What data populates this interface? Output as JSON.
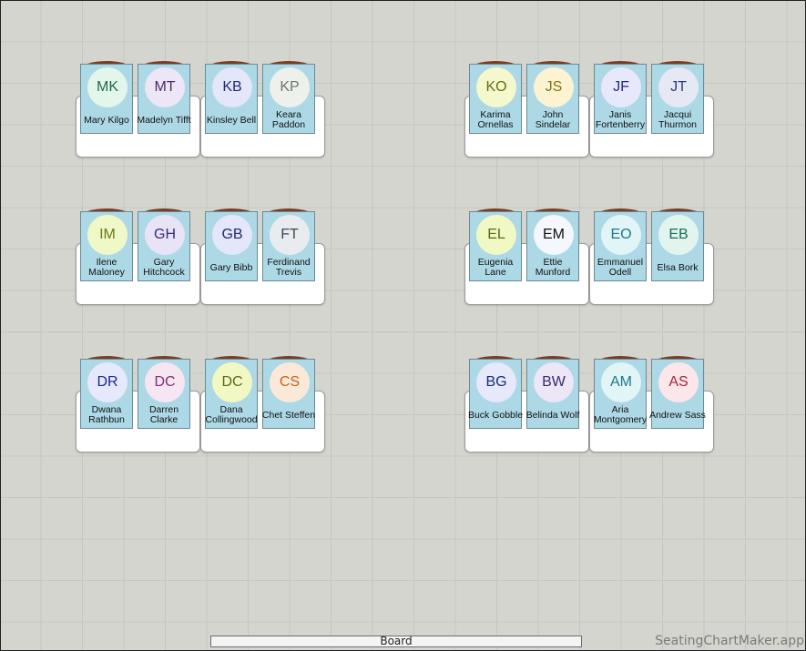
{
  "board_label": "Board",
  "watermark": "SeatingChartMaker.app",
  "colors": {
    "card_bg": "#add8e6",
    "desk_bg": "#ffffff",
    "chair": "#7a3d22"
  },
  "students": [
    {
      "initials": "MK",
      "name": "Mary Kilgo",
      "circle": "#e3f6ec",
      "text": "#1f6b4a"
    },
    {
      "initials": "MT",
      "name": "Madelyn Tifft",
      "circle": "#ece6f6",
      "text": "#4a2a6b"
    },
    {
      "initials": "KB",
      "name": "Kinsley Bell",
      "circle": "#e4e6fa",
      "text": "#222a7a"
    },
    {
      "initials": "KP",
      "name": "Keara Paddon",
      "circle": "#eef0ec",
      "text": "#6a7a6a"
    },
    {
      "initials": "KO",
      "name": "Karima Ornellas",
      "circle": "#f4f8cc",
      "text": "#6b6b12"
    },
    {
      "initials": "JS",
      "name": "John Sindelar",
      "circle": "#fbf3d2",
      "text": "#8a7212"
    },
    {
      "initials": "JF",
      "name": "Janis Fortenberry",
      "circle": "#e7e9fb",
      "text": "#1f2a8a"
    },
    {
      "initials": "JT",
      "name": "Jacqui Thurmon",
      "circle": "#e6e8f4",
      "text": "#2a3a7a"
    },
    {
      "initials": "IM",
      "name": "Ilene Maloney",
      "circle": "#f0f8c8",
      "text": "#6a7a14"
    },
    {
      "initials": "GH",
      "name": "Gary Hitchcock",
      "circle": "#e8e4f6",
      "text": "#3a2a7a"
    },
    {
      "initials": "GB",
      "name": "Gary Bibb",
      "circle": "#e4e6fa",
      "text": "#222a6a"
    },
    {
      "initials": "FT",
      "name": "Ferdinand Trevis",
      "circle": "#e9ecef",
      "text": "#3a4a5a"
    },
    {
      "initials": "EL",
      "name": "Eugenia Lane",
      "circle": "#f0f8c4",
      "text": "#5a6a12"
    },
    {
      "initials": "EM",
      "name": "Ettie Munford",
      "circle": "#f4f7fb",
      "text": "#111111"
    },
    {
      "initials": "EO",
      "name": "Emmanuel Odell",
      "circle": "#e1f4f6",
      "text": "#1a7a8a"
    },
    {
      "initials": "EB",
      "name": "Elsa Bork",
      "circle": "#e2f4ee",
      "text": "#1a6a5a"
    },
    {
      "initials": "DR",
      "name": "Dwana Rathbun",
      "circle": "#e6e8fb",
      "text": "#1a2a8a"
    },
    {
      "initials": "DC",
      "name": "Darren Clarke",
      "circle": "#f6e6f2",
      "text": "#8a2a7a"
    },
    {
      "initials": "DC",
      "name": "Dana Collingwood",
      "circle": "#f1f8c4",
      "text": "#5a6a12"
    },
    {
      "initials": "CS",
      "name": "Chet Steffen",
      "circle": "#fbe9d8",
      "text": "#c0641a"
    },
    {
      "initials": "BG",
      "name": "Buck Gobble",
      "circle": "#e6e8fb",
      "text": "#1a2a7a"
    },
    {
      "initials": "BW",
      "name": "Belinda Wolf",
      "circle": "#ece6f6",
      "text": "#3a2a6a"
    },
    {
      "initials": "AM",
      "name": "Aria Montgomery",
      "circle": "#e1f4f6",
      "text": "#1a7a8a"
    },
    {
      "initials": "AS",
      "name": "Andrew Sass",
      "circle": "#fbe6ea",
      "text": "#a0283a"
    }
  ]
}
